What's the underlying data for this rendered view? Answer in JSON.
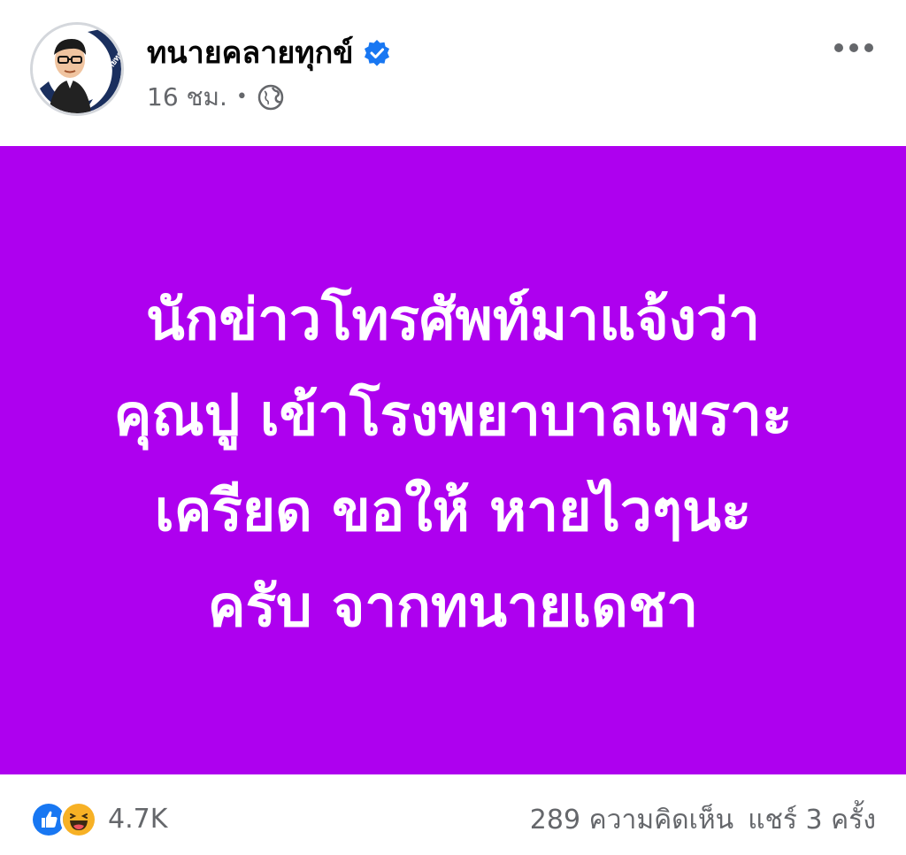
{
  "post": {
    "author": "ทนายคลายทุกข์",
    "avatar_text": "ทนายคลายทุกข์",
    "time": "16 ชม.",
    "separator": "•",
    "icons": {
      "verified": "verified-badge-icon",
      "audience": "globe-icon",
      "more": "more-options-icon"
    },
    "background_color": "#ae00ef",
    "text_lines": [
      "นักข่าวโทรศัพท์มาแจ้งว่า",
      "คุณปู เข้าโรงพยาบาลเพราะ",
      "เครียด ขอให้ หายไวๆนะ",
      "ครับ จากทนายเดชา"
    ]
  },
  "footer": {
    "reaction_icons": [
      "like-icon",
      "haha-icon"
    ],
    "reaction_count": "4.7K",
    "comments": "289 ความคิดเห็น",
    "shares": "แชร์ 3 ครั้ง"
  },
  "colors": {
    "brand_blue": "#1877f2",
    "muted_text": "#65676b",
    "post_background": "#ae00ef"
  }
}
